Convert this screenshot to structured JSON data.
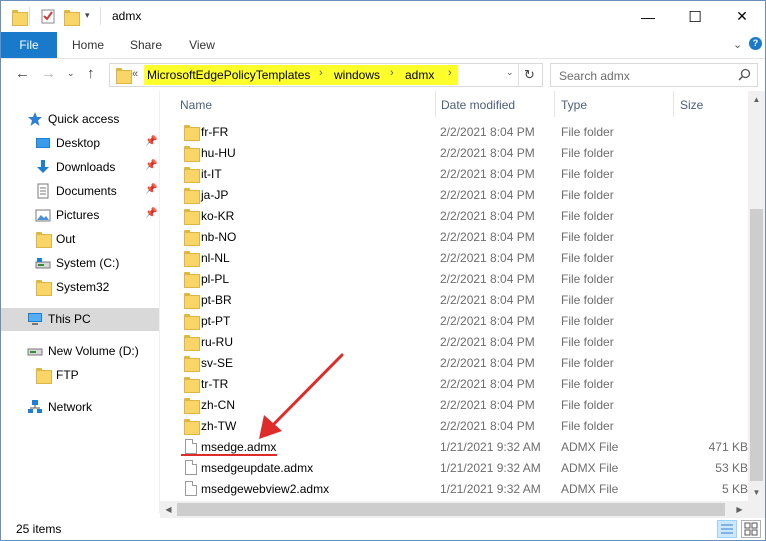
{
  "window": {
    "title": "admx",
    "controls": {
      "minimize": "—",
      "maximize": "☐",
      "close": "✕"
    }
  },
  "ribbon": {
    "tabs": [
      "File",
      "Home",
      "Share",
      "View"
    ],
    "collapse_icon": "chevron-down-icon",
    "help_icon": "help-icon"
  },
  "address": {
    "overflow": "«",
    "crumbs": [
      "MicrosoftEdgePolicyTemplates",
      "windows",
      "admx"
    ],
    "highlight_color": "#ffff2c"
  },
  "search": {
    "placeholder": "Search admx"
  },
  "nav": {
    "quick_access": "Quick access",
    "quick_items": [
      {
        "label": "Desktop",
        "icon": "desktop-icon",
        "pinned": true
      },
      {
        "label": "Downloads",
        "icon": "downloads-icon",
        "pinned": true
      },
      {
        "label": "Documents",
        "icon": "documents-icon",
        "pinned": true
      },
      {
        "label": "Pictures",
        "icon": "pictures-icon",
        "pinned": true
      },
      {
        "label": "Out",
        "icon": "folder-icon",
        "pinned": false
      },
      {
        "label": "System (C:)",
        "icon": "drive-icon",
        "pinned": false
      },
      {
        "label": "System32",
        "icon": "folder-icon",
        "pinned": false
      }
    ],
    "this_pc": "This PC",
    "volume": "New Volume (D:)",
    "ftp": "FTP",
    "network": "Network"
  },
  "columns": {
    "name": "Name",
    "date": "Date modified",
    "type": "Type",
    "size": "Size"
  },
  "rows": [
    {
      "name": "fr-FR",
      "date": "2/2/2021 8:04 PM",
      "type": "File folder",
      "size": "",
      "kind": "folder"
    },
    {
      "name": "hu-HU",
      "date": "2/2/2021 8:04 PM",
      "type": "File folder",
      "size": "",
      "kind": "folder"
    },
    {
      "name": "it-IT",
      "date": "2/2/2021 8:04 PM",
      "type": "File folder",
      "size": "",
      "kind": "folder"
    },
    {
      "name": "ja-JP",
      "date": "2/2/2021 8:04 PM",
      "type": "File folder",
      "size": "",
      "kind": "folder"
    },
    {
      "name": "ko-KR",
      "date": "2/2/2021 8:04 PM",
      "type": "File folder",
      "size": "",
      "kind": "folder"
    },
    {
      "name": "nb-NO",
      "date": "2/2/2021 8:04 PM",
      "type": "File folder",
      "size": "",
      "kind": "folder"
    },
    {
      "name": "nl-NL",
      "date": "2/2/2021 8:04 PM",
      "type": "File folder",
      "size": "",
      "kind": "folder"
    },
    {
      "name": "pl-PL",
      "date": "2/2/2021 8:04 PM",
      "type": "File folder",
      "size": "",
      "kind": "folder"
    },
    {
      "name": "pt-BR",
      "date": "2/2/2021 8:04 PM",
      "type": "File folder",
      "size": "",
      "kind": "folder"
    },
    {
      "name": "pt-PT",
      "date": "2/2/2021 8:04 PM",
      "type": "File folder",
      "size": "",
      "kind": "folder"
    },
    {
      "name": "ru-RU",
      "date": "2/2/2021 8:04 PM",
      "type": "File folder",
      "size": "",
      "kind": "folder"
    },
    {
      "name": "sv-SE",
      "date": "2/2/2021 8:04 PM",
      "type": "File folder",
      "size": "",
      "kind": "folder"
    },
    {
      "name": "tr-TR",
      "date": "2/2/2021 8:04 PM",
      "type": "File folder",
      "size": "",
      "kind": "folder"
    },
    {
      "name": "zh-CN",
      "date": "2/2/2021 8:04 PM",
      "type": "File folder",
      "size": "",
      "kind": "folder"
    },
    {
      "name": "zh-TW",
      "date": "2/2/2021 8:04 PM",
      "type": "File folder",
      "size": "",
      "kind": "folder"
    },
    {
      "name": "msedge.admx",
      "date": "1/21/2021 9:32 AM",
      "type": "ADMX File",
      "size": "471 KB",
      "kind": "file"
    },
    {
      "name": "msedgeupdate.admx",
      "date": "1/21/2021 9:32 AM",
      "type": "ADMX File",
      "size": "53 KB",
      "kind": "file"
    },
    {
      "name": "msedgewebview2.admx",
      "date": "1/21/2021 9:32 AM",
      "type": "ADMX File",
      "size": "5 KB",
      "kind": "file"
    }
  ],
  "status": {
    "item_count": "25 items"
  },
  "annotation": {
    "color": "#e02b2b",
    "target": "msedge.admx"
  }
}
